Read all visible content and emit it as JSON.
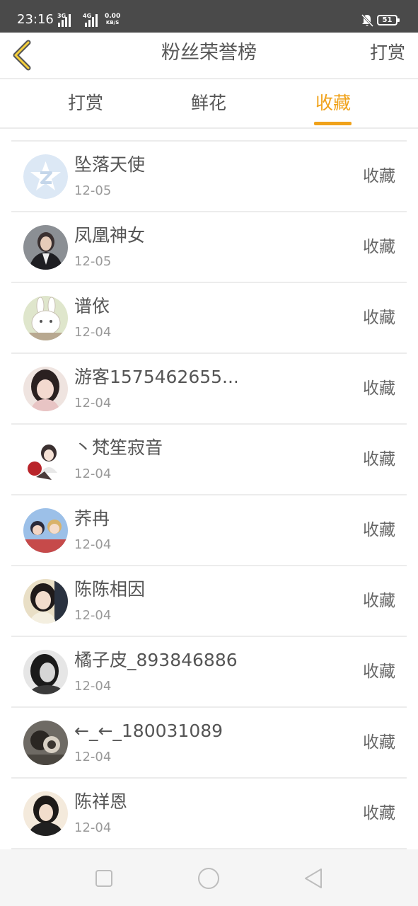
{
  "status_bar": {
    "time": "23:16",
    "net1": "3G",
    "net2": "4G",
    "speed_value": "0.00",
    "speed_unit": "KB/S",
    "battery": "51"
  },
  "header": {
    "title": "粉丝荣誉榜",
    "action_label": "打赏",
    "back_icon": "chevron-left-icon",
    "accent_color": "#f0a21a"
  },
  "tabs": [
    {
      "label": "打赏",
      "active": false
    },
    {
      "label": "鲜花",
      "active": false
    },
    {
      "label": "收藏",
      "active": true
    }
  ],
  "fans": [
    {
      "name": "坠落天使",
      "date": "12-05",
      "action": "收藏",
      "avatar": "default-avatar"
    },
    {
      "name": "凤凰神女",
      "date": "12-05",
      "action": "收藏",
      "avatar": "user-avatar"
    },
    {
      "name": "谱依",
      "date": "12-04",
      "action": "收藏",
      "avatar": "user-avatar"
    },
    {
      "name": "游客1575462655...",
      "date": "12-04",
      "action": "收藏",
      "avatar": "user-avatar"
    },
    {
      "name": "丶梵笙寂音",
      "date": "12-04",
      "action": "收藏",
      "avatar": "user-avatar"
    },
    {
      "name": "荞冉",
      "date": "12-04",
      "action": "收藏",
      "avatar": "user-avatar"
    },
    {
      "name": "陈陈相因",
      "date": "12-04",
      "action": "收藏",
      "avatar": "user-avatar"
    },
    {
      "name": "橘子皮_893846886",
      "date": "12-04",
      "action": "收藏",
      "avatar": "user-avatar"
    },
    {
      "name": "←_←_180031089",
      "date": "12-04",
      "action": "收藏",
      "avatar": "user-avatar"
    },
    {
      "name": "陈祥恩",
      "date": "12-04",
      "action": "收藏",
      "avatar": "user-avatar"
    }
  ]
}
